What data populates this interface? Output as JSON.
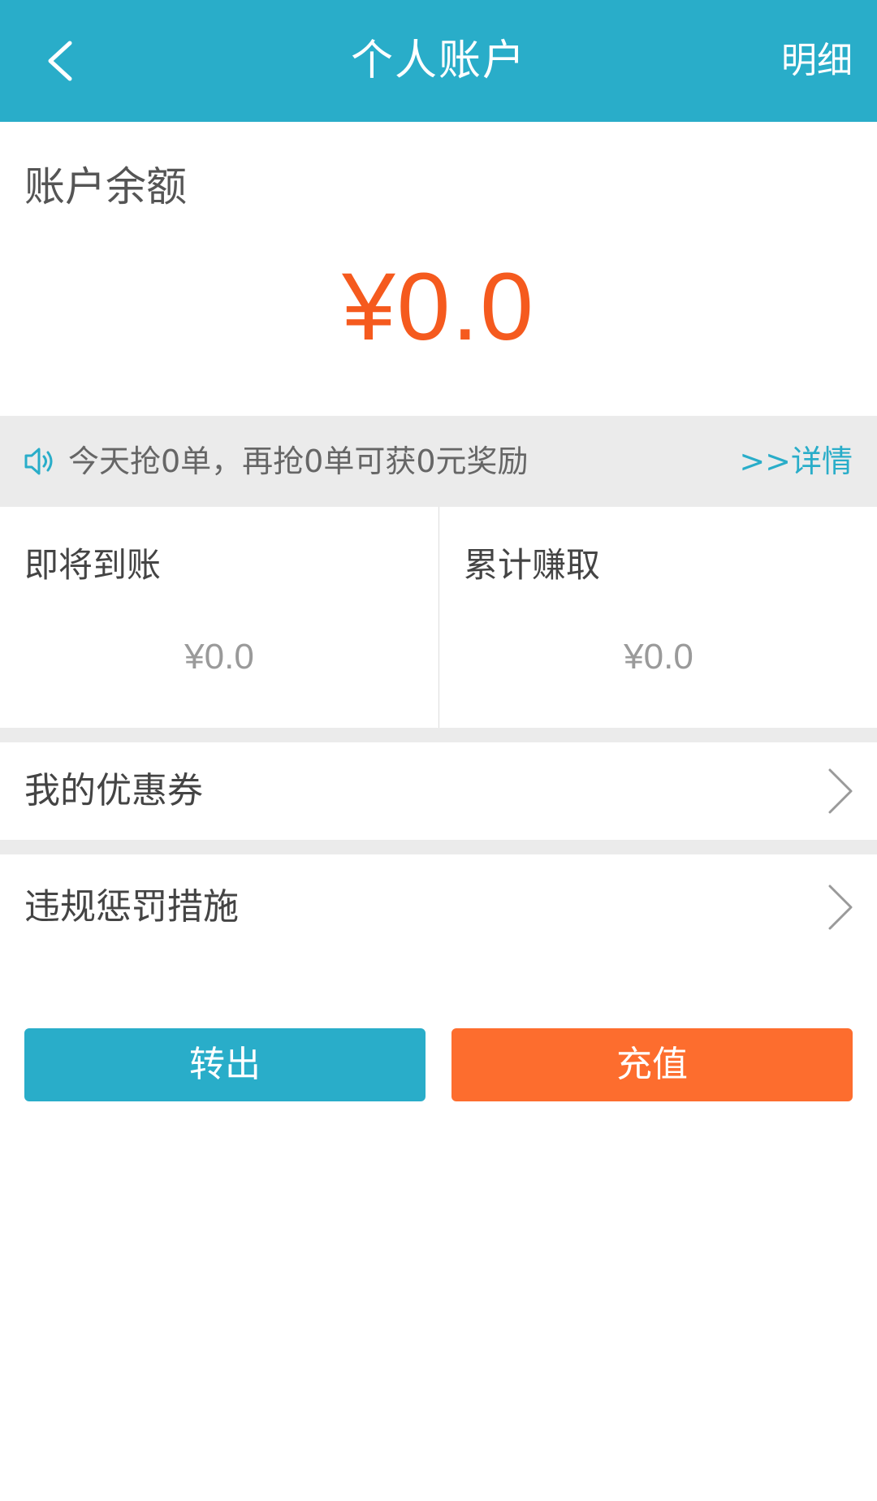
{
  "header": {
    "title": "个人账户",
    "action_label": "明细"
  },
  "balance": {
    "label": "账户余额",
    "amount": "¥0.0"
  },
  "notice": {
    "text": "今天抢0单，再抢0单可获0元奖励",
    "link_label": ">>详情"
  },
  "stats": {
    "incoming": {
      "label": "即将到账",
      "value": "¥0.0"
    },
    "earned": {
      "label": "累计赚取",
      "value": "¥0.0"
    }
  },
  "menu": {
    "coupons_label": "我的优惠券",
    "penalty_label": "违规惩罚措施"
  },
  "actions": {
    "withdraw_label": "转出",
    "recharge_label": "充值"
  },
  "colors": {
    "primary": "#29adc9",
    "accent_orange": "#fd6d2e",
    "balance_orange": "#f55a1e"
  }
}
